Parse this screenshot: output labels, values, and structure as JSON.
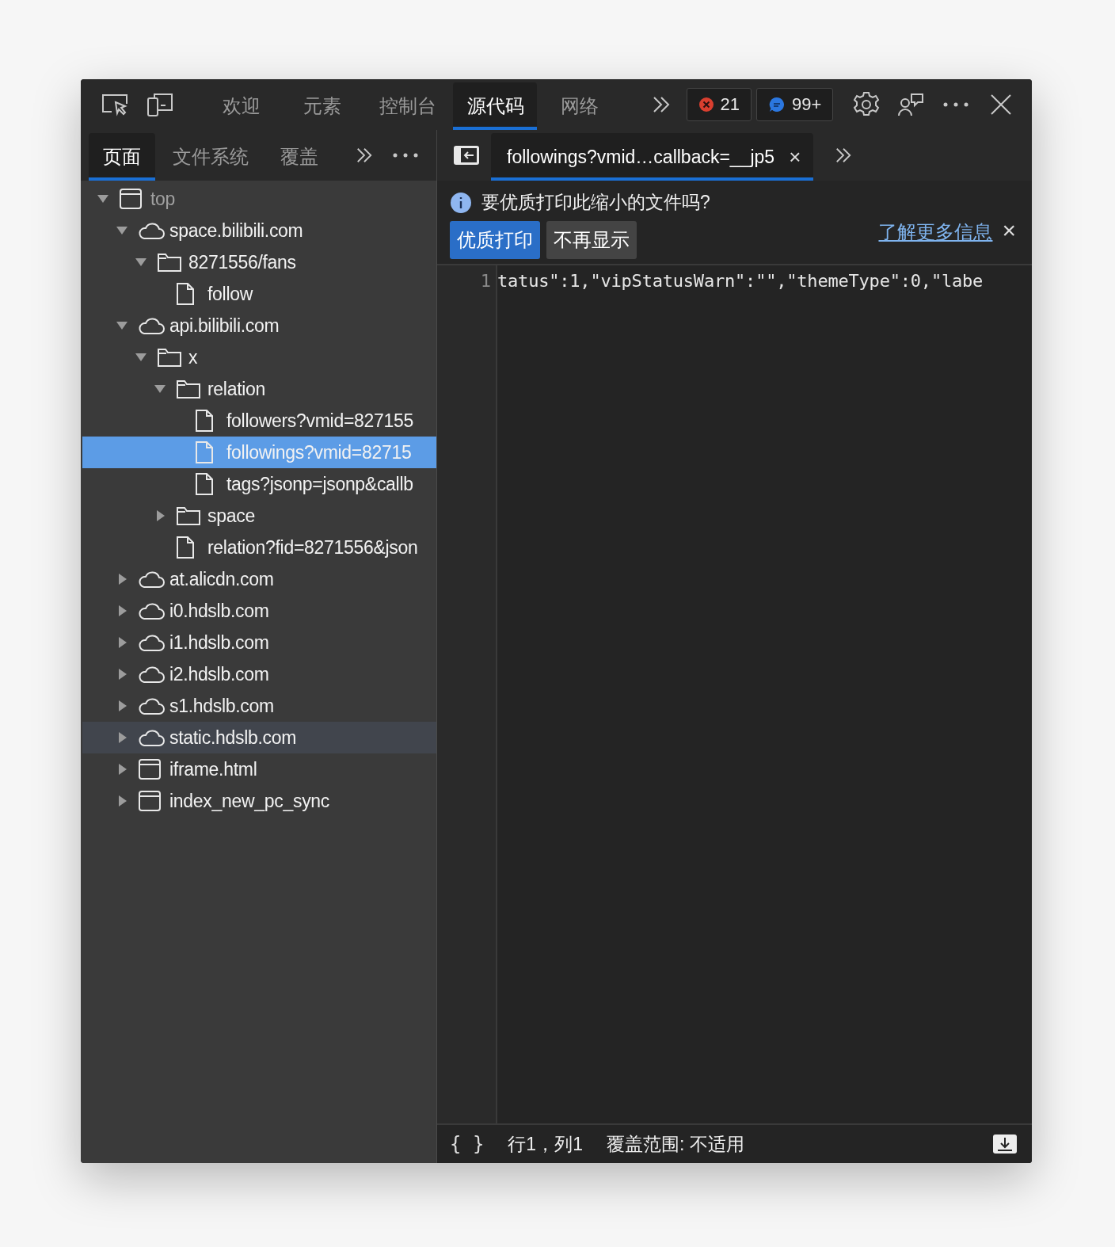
{
  "main_tabs": [
    {
      "label": "欢迎",
      "selected": false
    },
    {
      "label": "元素",
      "selected": false
    },
    {
      "label": "控制台",
      "selected": false
    },
    {
      "label": "源代码",
      "selected": true
    },
    {
      "label": "网络",
      "selected": false
    }
  ],
  "badges": [
    {
      "kind": "error",
      "count": "21"
    },
    {
      "kind": "message",
      "count": "99+"
    }
  ],
  "navigator_tabs": [
    {
      "label": "页面",
      "selected": true
    },
    {
      "label": "文件系统",
      "selected": false
    },
    {
      "label": "覆盖",
      "selected": false
    }
  ],
  "file_tabs": [
    {
      "label": "followings?vmid…callback=__jp5",
      "selected": true,
      "close": "×"
    }
  ],
  "tree": [
    {
      "kind": "frame",
      "label": "top",
      "expanded": true,
      "selected": false,
      "hovered": false,
      "children": [
        {
          "kind": "cloud",
          "label": "space.bilibili.com",
          "expanded": true,
          "selected": false,
          "hovered": false,
          "children": [
            {
              "kind": "folder",
              "label": "8271556/fans",
              "expanded": true,
              "selected": false,
              "hovered": false,
              "children": [
                {
                  "kind": "file",
                  "label": "follow",
                  "selected": false,
                  "hovered": false
                }
              ]
            }
          ]
        },
        {
          "kind": "cloud",
          "label": "api.bilibili.com",
          "expanded": true,
          "selected": false,
          "hovered": false,
          "children": [
            {
              "kind": "folder",
              "label": "x",
              "expanded": true,
              "selected": false,
              "hovered": false,
              "children": [
                {
                  "kind": "folder",
                  "label": "relation",
                  "expanded": true,
                  "selected": false,
                  "hovered": false,
                  "children": [
                    {
                      "kind": "file",
                      "label": "followers?vmid=827155",
                      "selected": false,
                      "hovered": false
                    },
                    {
                      "kind": "file",
                      "label": "followings?vmid=82715",
                      "selected": true,
                      "hovered": false
                    },
                    {
                      "kind": "file",
                      "label": "tags?jsonp=jsonp&callb",
                      "selected": false,
                      "hovered": false
                    }
                  ]
                },
                {
                  "kind": "folder",
                  "label": "space",
                  "expanded": false,
                  "selected": false,
                  "hovered": false
                },
                {
                  "kind": "file",
                  "label": "relation?fid=8271556&json",
                  "selected": false,
                  "hovered": false
                }
              ]
            }
          ]
        },
        {
          "kind": "cloud",
          "label": "at.alicdn.com",
          "expanded": false,
          "selected": false,
          "hovered": false
        },
        {
          "kind": "cloud",
          "label": "i0.hdslb.com",
          "expanded": false,
          "selected": false,
          "hovered": false
        },
        {
          "kind": "cloud",
          "label": "i1.hdslb.com",
          "expanded": false,
          "selected": false,
          "hovered": false
        },
        {
          "kind": "cloud",
          "label": "i2.hdslb.com",
          "expanded": false,
          "selected": false,
          "hovered": false
        },
        {
          "kind": "cloud",
          "label": "s1.hdslb.com",
          "expanded": false,
          "selected": false,
          "hovered": false
        },
        {
          "kind": "cloud",
          "label": "static.hdslb.com",
          "expanded": false,
          "selected": false,
          "hovered": true
        },
        {
          "kind": "frame",
          "label": "iframe.html",
          "expanded": false,
          "selected": false,
          "hovered": false
        },
        {
          "kind": "frame",
          "label": "index_new_pc_sync",
          "expanded": false,
          "selected": false,
          "hovered": false
        }
      ]
    }
  ],
  "infobar": {
    "message": "要优质打印此缩小的文件吗?",
    "link": "了解更多信息",
    "close": "×",
    "buttons": [
      {
        "label": "优质打印",
        "primary": true
      },
      {
        "label": "不再显示",
        "primary": false
      }
    ]
  },
  "editor": {
    "lines": [
      {
        "number": "1",
        "code": "tatus\":1,\"vipStatusWarn\":\"\",\"themeType\":0,\"labe"
      }
    ]
  },
  "status_bar": {
    "pretty_print": "{ }",
    "position": "行1，列1",
    "coverage": "覆盖范围: 不适用"
  }
}
